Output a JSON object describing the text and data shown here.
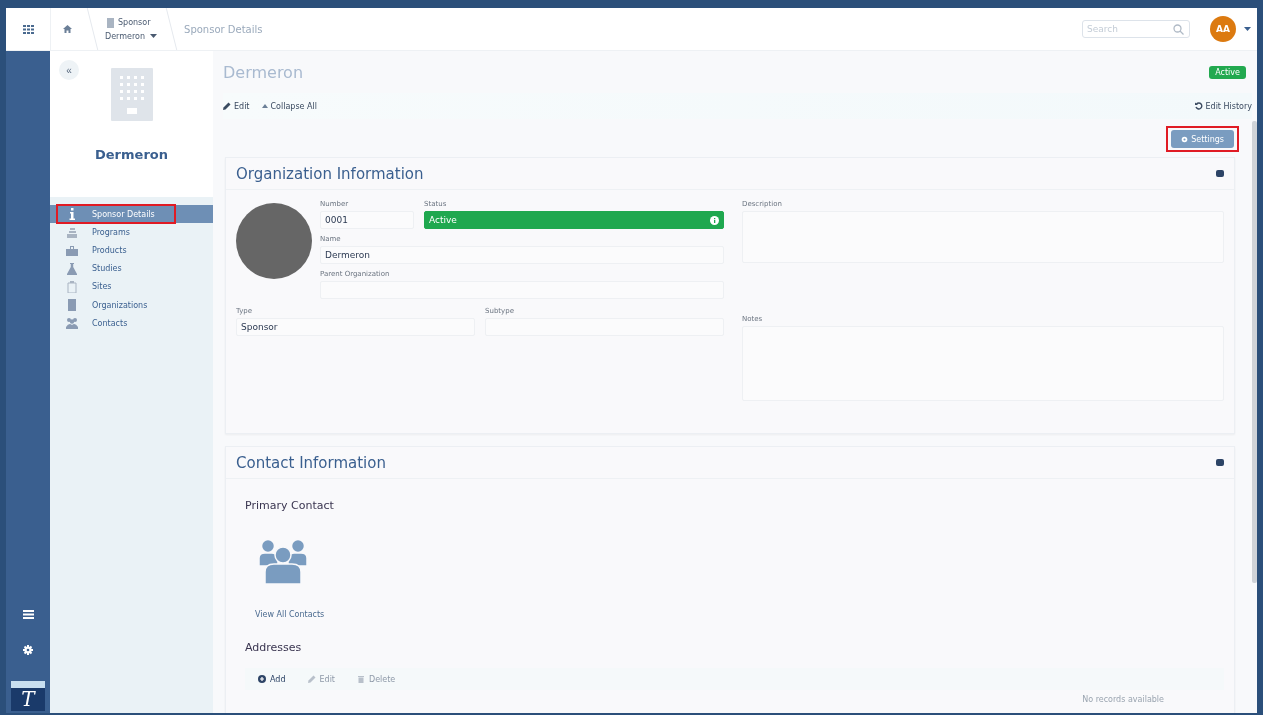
{
  "topbar": {
    "breadcrumb": {
      "entity_type": "Sponsor",
      "entity_name": "Dermeron",
      "page": "Sponsor Details"
    },
    "search": {
      "placeholder": "Search"
    },
    "user_initials": "AA"
  },
  "rail": {
    "logo_letter": "T"
  },
  "sidebar": {
    "collapse_button": "«",
    "title": "Dermeron",
    "items": [
      {
        "label": "Sponsor Details",
        "selected": true,
        "highlighted": true,
        "kind": "info"
      },
      {
        "label": "Programs",
        "selected": false,
        "highlighted": false,
        "kind": "stack"
      },
      {
        "label": "Products",
        "selected": false,
        "highlighted": false,
        "kind": "bag"
      },
      {
        "label": "Studies",
        "selected": false,
        "highlighted": false,
        "kind": "flask"
      },
      {
        "label": "Sites",
        "selected": false,
        "highlighted": false,
        "kind": "building"
      },
      {
        "label": "Organizations",
        "selected": false,
        "highlighted": false,
        "kind": "tower"
      },
      {
        "label": "Contacts",
        "selected": false,
        "highlighted": false,
        "kind": "people"
      }
    ]
  },
  "header": {
    "title": "Dermeron",
    "status_badge": "Active"
  },
  "toolbar": {
    "edit": "Edit",
    "collapse_all": "Collapse All",
    "edit_history": "Edit History",
    "settings": {
      "label": "Settings",
      "highlighted": true
    }
  },
  "organization": {
    "title": "Organization Information",
    "number": {
      "label": "Number",
      "value": "0001"
    },
    "status": {
      "label": "Status",
      "value": "Active"
    },
    "name": {
      "label": "Name",
      "value": "Dermeron"
    },
    "parent": {
      "label": "Parent Organization"
    },
    "type": {
      "label": "Type",
      "value": "Sponsor"
    },
    "subtype": {
      "label": "Subtype"
    },
    "description": {
      "label": "Description"
    },
    "notes": {
      "label": "Notes"
    }
  },
  "contact": {
    "title": "Contact Information",
    "primary_contact": "Primary Contact",
    "view_all": "View All Contacts",
    "addresses": {
      "title": "Addresses",
      "actions": [
        {
          "label": "Add",
          "disabled": false,
          "kind": "plus"
        },
        {
          "label": "Edit",
          "disabled": true,
          "kind": "pencil"
        },
        {
          "label": "Delete",
          "disabled": true,
          "kind": "trash"
        }
      ],
      "empty": "No records available"
    }
  }
}
